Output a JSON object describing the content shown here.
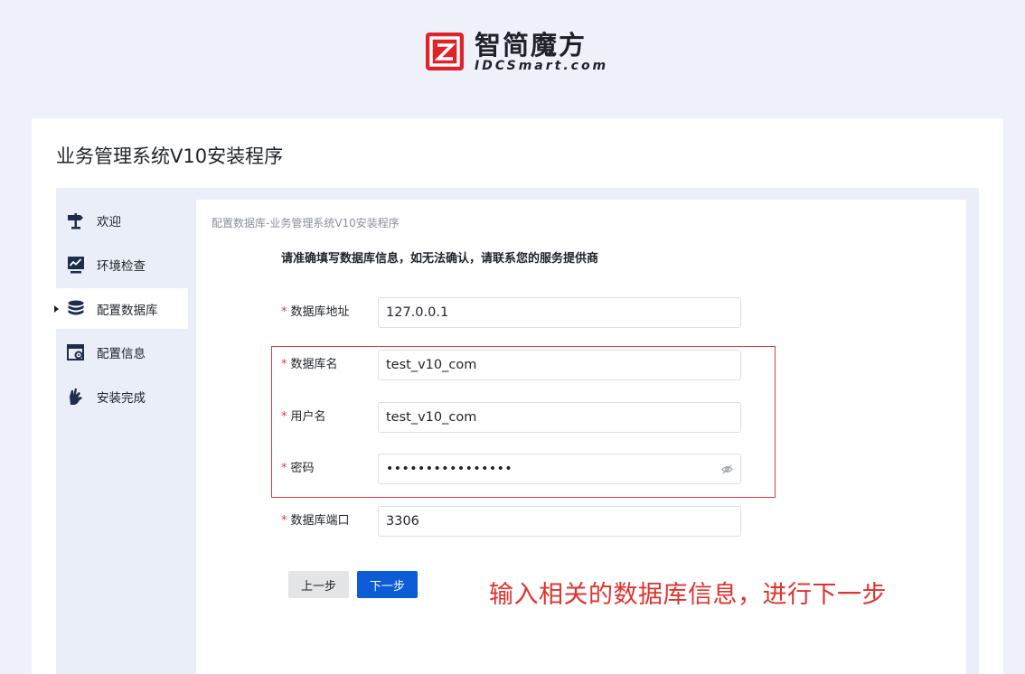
{
  "brand": {
    "name_cn": "智简魔方",
    "name_en": "IDCSmart.com",
    "accent_color": "#e0222b"
  },
  "page": {
    "title": "业务管理系统V10安装程序"
  },
  "sidebar": {
    "items": [
      {
        "label": "欢迎",
        "icon": "signpost-icon",
        "active": false
      },
      {
        "label": "环境检查",
        "icon": "chart-monitor-icon",
        "active": false
      },
      {
        "label": "配置数据库",
        "icon": "database-icon",
        "active": true
      },
      {
        "label": "配置信息",
        "icon": "settings-window-icon",
        "active": false
      },
      {
        "label": "安装完成",
        "icon": "ok-hand-icon",
        "active": false
      }
    ]
  },
  "panel": {
    "breadcrumb": "配置数据库-业务管理系统V10安装程序",
    "notice": "请准确填写数据库信息，如无法确认，请联系您的服务提供商",
    "required_mark": "*",
    "fields": {
      "db_host": {
        "label": "数据库地址",
        "value": "127.0.0.1"
      },
      "db_name": {
        "label": "数据库名",
        "value": "test_v10_com"
      },
      "db_user": {
        "label": "用户名",
        "value": "test_v10_com"
      },
      "db_password": {
        "label": "密码",
        "value": "••••••••••••••••"
      },
      "db_port": {
        "label": "数据库端口",
        "value": "3306"
      }
    },
    "buttons": {
      "prev": "上一步",
      "next": "下一步"
    }
  },
  "annotation": {
    "text": "输入相关的数据库信息，进行下一步",
    "color": "#e0322f"
  }
}
